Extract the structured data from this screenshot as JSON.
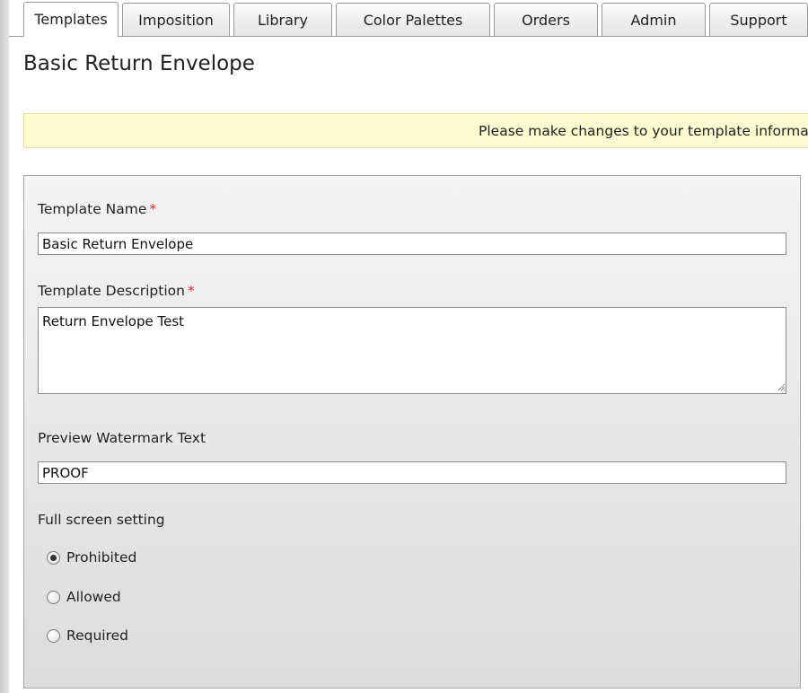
{
  "tabs": [
    {
      "label": "Templates",
      "active": true
    },
    {
      "label": "Imposition",
      "active": false
    },
    {
      "label": "Library",
      "active": false
    },
    {
      "label": "Color Palettes",
      "active": false
    },
    {
      "label": "Orders",
      "active": false
    },
    {
      "label": "Admin",
      "active": false
    },
    {
      "label": "Support",
      "active": false
    }
  ],
  "page": {
    "title": "Basic Return Envelope",
    "notice": "Please make changes to your template informa"
  },
  "form": {
    "template_name": {
      "label": "Template Name",
      "required_mark": "*",
      "value": "Basic Return Envelope"
    },
    "template_description": {
      "label": "Template Description",
      "required_mark": "*",
      "value": "Return Envelope Test"
    },
    "watermark": {
      "label": "Preview Watermark Text",
      "value": "PROOF"
    },
    "full_screen": {
      "label": "Full screen setting",
      "options": [
        {
          "label": "Prohibited",
          "checked": true
        },
        {
          "label": "Allowed",
          "checked": false
        },
        {
          "label": "Required",
          "checked": false
        }
      ]
    }
  },
  "colors": {
    "notice_bg": "#fffbd0",
    "required": "#d03030",
    "panel_top": "#f4f4f4",
    "panel_bottom": "#dcdcdc"
  },
  "icons": {
    "textarea_resize": "resize-grip-icon"
  }
}
